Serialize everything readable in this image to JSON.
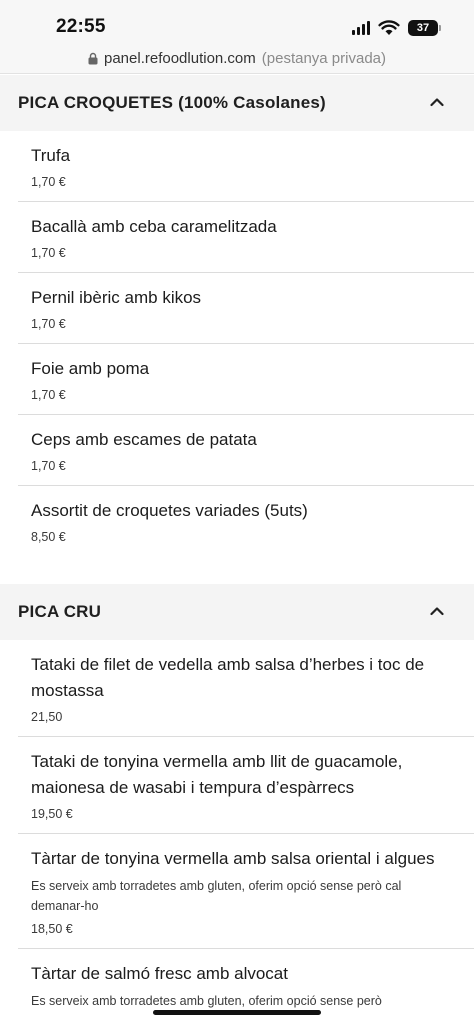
{
  "status_bar": {
    "time": "22:55",
    "battery": "37"
  },
  "url_bar": {
    "domain": "panel.refoodlution.com",
    "note": "(pestanya privada)"
  },
  "sections": [
    {
      "title": "PICA CROQUETES (100% Casolanes)",
      "items": [
        {
          "name": "Trufa",
          "price": "1,70 €"
        },
        {
          "name": "Bacallà amb ceba caramelitzada",
          "price": "1,70 €"
        },
        {
          "name": "Pernil ibèric amb kikos",
          "price": "1,70 €"
        },
        {
          "name": "Foie amb poma",
          "price": "1,70 €"
        },
        {
          "name": "Ceps amb escames de patata",
          "price": "1,70 €"
        },
        {
          "name": "Assortit de croquetes variades (5uts)",
          "price": "8,50 €"
        }
      ]
    },
    {
      "title": "PICA CRU",
      "items": [
        {
          "name": "Tataki de filet de vedella amb salsa d’herbes i toc de mostassa",
          "price": "21,50"
        },
        {
          "name": "Tataki de tonyina vermella amb llit de guacamole, maionesa de wasabi i tempura d’espàrrecs",
          "price": "19,50 €"
        },
        {
          "name": "Tàrtar de tonyina vermella amb salsa oriental i algues",
          "desc": "Es serveix amb torradetes amb gluten, oferim opció sense però cal demanar-ho",
          "price": "18,50 €"
        },
        {
          "name": "Tàrtar de salmó fresc amb alvocat",
          "desc": "Es serveix amb torradetes amb gluten, oferim opció sense però"
        }
      ]
    }
  ]
}
